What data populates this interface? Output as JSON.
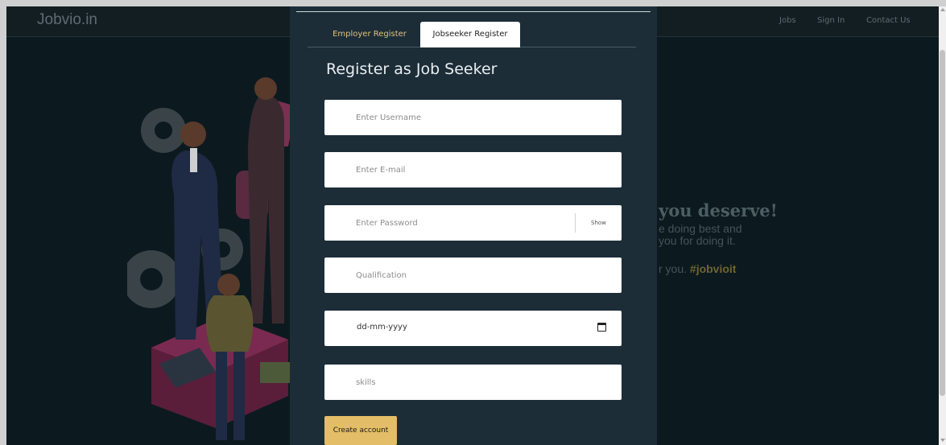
{
  "navbar": {
    "brand": "Jobvio.in",
    "links": [
      {
        "label": "Jobs"
      },
      {
        "label": "Sign In"
      },
      {
        "label": "Contact Us"
      }
    ]
  },
  "hero": {
    "heading": "you deserve!",
    "line1": "e doing best and",
    "line2": "you for doing it.",
    "line3_prefix": "r you. ",
    "line3_tag": "#jobvioit"
  },
  "modal": {
    "tabs": [
      {
        "label": "Employer Register"
      },
      {
        "label": "Jobseeker Register"
      }
    ],
    "title": "Register as Job Seeker",
    "fields": {
      "username": {
        "placeholder": "Enter Username"
      },
      "email": {
        "placeholder": "Enter E-mail"
      },
      "password": {
        "placeholder": "Enter Password",
        "toggle": "Show"
      },
      "qualification": {
        "placeholder": "Qualification"
      },
      "dob": {
        "value": "dd-mm-yyyy"
      },
      "skills": {
        "placeholder": "skills"
      }
    },
    "submit": "Create account"
  },
  "colors": {
    "accent": "#e3bd67",
    "modal_bg": "#1c2d38",
    "page_bg": "#0c1a1f"
  },
  "icons": {
    "date": "calendar-icon"
  }
}
